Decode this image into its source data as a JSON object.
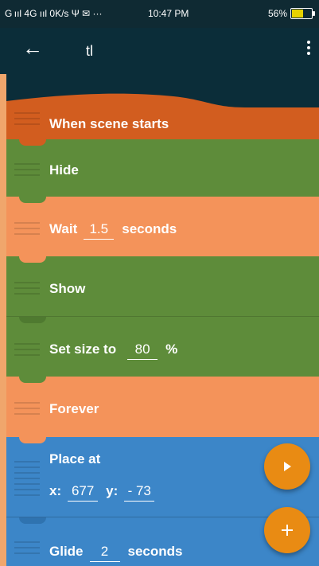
{
  "status_bar": {
    "left": "G ııl 4G ııl 0K/s Ψ ✉ ···",
    "time": "10:47 PM",
    "right": "56%",
    "battery_level": 0.56
  },
  "toolbar": {
    "title": "tl",
    "back_icon": "arrow-back-icon",
    "menu_icon": "more-vert-icon"
  },
  "bricks": {
    "when_scene_starts": "When scene starts",
    "hide": "Hide",
    "wait_label": "Wait",
    "wait_value": "1.5",
    "wait_unit": "seconds",
    "show": "Show",
    "set_size_label": "Set size to",
    "set_size_value": "80",
    "set_size_unit": "%",
    "forever": "Forever",
    "place_at_label": "Place at",
    "x_label": "x:",
    "x_value": "677",
    "y_label": "y:",
    "y_value": "- 73",
    "glide_label": "Glide",
    "glide_value": "2",
    "glide_unit": "seconds"
  },
  "colors": {
    "event": "#d25d1f",
    "looks": "#5e8c3a",
    "control": "#f4935a",
    "motion": "#3c86c8",
    "fab": "#e98b13",
    "toolbar": "#0b2d39"
  },
  "fabs": {
    "play_icon": "play-icon",
    "add_icon": "plus-icon"
  }
}
